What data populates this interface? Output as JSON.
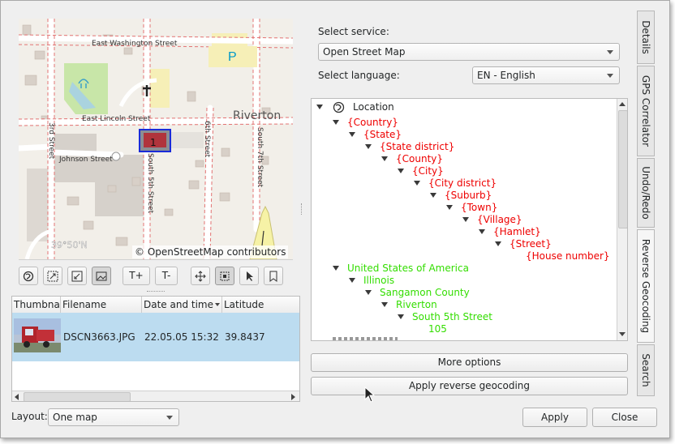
{
  "map": {
    "streets": {
      "east_washington": "East Washington Street",
      "east_lincoln": "East Lincoln Street",
      "johnson": "Johnson Street",
      "third": "3rd Street",
      "south_fifth": "South 5th Street",
      "sixth": "6th Street",
      "south_seventh": "South 7th Street"
    },
    "place_label": "Riverton",
    "coords_overlay": "39°50'N",
    "attribution": "© OpenStreetMap contributors",
    "parking_label": "P",
    "marker_count": "1"
  },
  "map_toolbar": {
    "buttons": [
      {
        "name": "globe-button",
        "icon": "globe-icon",
        "label": ""
      },
      {
        "name": "zoom-to-fit-button",
        "icon": "zoom-fit-icon",
        "label": ""
      },
      {
        "name": "zoom-to-selection-button",
        "icon": "zoom-selection-icon",
        "label": ""
      },
      {
        "name": "show-thumbnails-button",
        "icon": "image-icon",
        "label": ""
      },
      {
        "name": "increase-thumbnail-button",
        "icon": "",
        "label": "T+"
      },
      {
        "name": "decrease-thumbnail-button",
        "icon": "",
        "label": "T-"
      },
      {
        "name": "pan-mode-button",
        "icon": "move-icon",
        "label": ""
      },
      {
        "name": "select-region-button",
        "icon": "select-region-icon",
        "label": ""
      },
      {
        "name": "pointer-mode-button",
        "icon": "pointer-icon",
        "label": ""
      },
      {
        "name": "bookmark-button",
        "icon": "bookmark-icon",
        "label": ""
      }
    ]
  },
  "image_list": {
    "columns": [
      "Thumbna",
      "Filename",
      "Date and time",
      "Latitude"
    ],
    "rows": [
      {
        "filename": "DSCN3663.JPG",
        "datetime": "22.05.05 15:32",
        "latitude": "39.8437"
      }
    ]
  },
  "layout_select": {
    "label": "Layout:",
    "value": "One map"
  },
  "service": {
    "label": "Select service:",
    "value": "Open Street Map"
  },
  "language": {
    "label": "Select language:",
    "value": "EN - English"
  },
  "tree": {
    "root": "Location",
    "placeholders": [
      "{Country}",
      "{State}",
      "{State district}",
      "{County}",
      "{City}",
      "{City district}",
      "{Suburb}",
      "{Town}",
      "{Village}",
      "{Hamlet}",
      "{Street}",
      "{House number}"
    ],
    "results": [
      "United States of America",
      "Illinois",
      "Sangamon County",
      "Riverton",
      "South 5th Street",
      "105"
    ]
  },
  "buttons": {
    "more_options": "More options",
    "apply_reverse": "Apply reverse geocoding",
    "apply": "Apply",
    "close": "Close"
  },
  "side_tabs": [
    "Details",
    "GPS Correlator",
    "Undo/Redo",
    "Reverse Geocoding",
    "Search"
  ],
  "colors": {
    "placeholder_text": "#ee0000",
    "result_text": "#33dd00",
    "selection_bg": "#bcdcf0"
  }
}
